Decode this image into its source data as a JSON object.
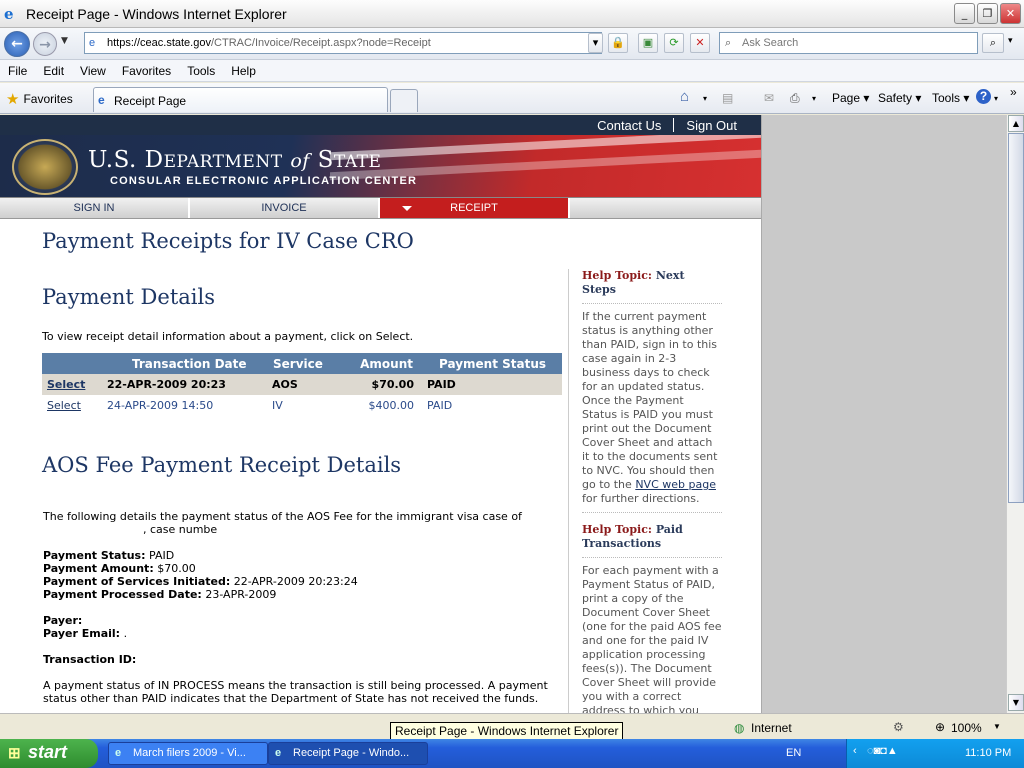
{
  "window": {
    "title": "Receipt Page - Windows Internet Explorer"
  },
  "address": {
    "url_prefix": "https://",
    "url_host": "ceac.state.gov",
    "url_path": "/CTRAC/Invoice/Receipt.aspx?node=Receipt",
    "search_placeholder": "Ask Search"
  },
  "menu": {
    "items": [
      "File",
      "Edit",
      "View",
      "Favorites",
      "Tools",
      "Help"
    ]
  },
  "favorites": {
    "label": "Favorites",
    "tab_title": "Receipt Page",
    "commands": [
      "Page",
      "Safety",
      "Tools"
    ]
  },
  "site": {
    "top_links": [
      "Contact Us",
      "Sign Out"
    ],
    "dept_a": "U.S. D",
    "dept_b": "EPARTMENT",
    "dept_of": "of",
    "dept_c": "S",
    "dept_d": "TATE",
    "subtitle": "CONSULAR ELECTRONIC APPLICATION CENTER",
    "nav_tabs": [
      "SIGN IN",
      "INVOICE",
      "RECEIPT"
    ]
  },
  "content": {
    "title": "Payment Receipts for IV Case CRO",
    "details_heading": "Payment Details",
    "intro": "To view receipt detail information about a payment, click on Select.",
    "table_headers": [
      "",
      "Transaction Date",
      "Service",
      "Amount",
      "Payment Status"
    ],
    "rows": [
      {
        "select": "Select",
        "date": "22-APR-2009 20:23",
        "service": "AOS",
        "amount": "$70.00",
        "status": "PAID"
      },
      {
        "select": "Select",
        "date": "24-APR-2009 14:50",
        "service": "IV",
        "amount": "$400.00",
        "status": "PAID"
      }
    ],
    "receipt_heading": "AOS Fee Payment Receipt Details",
    "desc_line1": "The following details the payment status of the AOS Fee for the immigrant visa case of",
    "desc_line2": ", case numbe",
    "fields": [
      {
        "label": "Payment Status:",
        "value": "PAID"
      },
      {
        "label": "Payment Amount:",
        "value": "$70.00"
      },
      {
        "label": "Payment of Services Initiated:",
        "value": "22-APR-2009 20:23:24"
      },
      {
        "label": "Payment Processed Date:",
        "value": "23-APR-2009"
      }
    ],
    "payer_label": "Payer:",
    "payer_email_label": "Payer Email:",
    "payer_email_value": ".",
    "transaction_label": "Transaction ID:",
    "footnote": "A payment status of IN PROCESS means the transaction is still being processed. A payment status other than PAID indicates that the Department of State has not received the funds."
  },
  "sidebar": {
    "help_prefix": "Help Topic:",
    "topic1_title": "Next Steps",
    "topic1_body_a": "If the current payment status is anything other than PAID, sign in to this case again in 2-3 business days to check for an updated status. Once the Payment Status is PAID you must print out the Document Cover Sheet and attach it to the documents sent to NVC. You should then go to the",
    "topic1_link": "NVC web page",
    "topic1_body_b": "for further directions.",
    "topic2_title": "Paid Transactions",
    "topic2_body": "For each payment with a Payment Status of PAID, print a copy of the Document Cover Sheet (one for the paid AOS fee and one for the paid IV application processing fees(s)). The Document Cover Sheet will provide you with a correct address to which you must return your"
  },
  "status": {
    "tooltip": "Receipt Page - Windows Internet Explorer",
    "zone": "Internet",
    "zoom": "100%"
  },
  "taskbar": {
    "start": "start",
    "task1": "March filers 2009 - Vi...",
    "task2": "Receipt Page - Windo...",
    "lang": "EN",
    "clock": "11:10 PM"
  }
}
